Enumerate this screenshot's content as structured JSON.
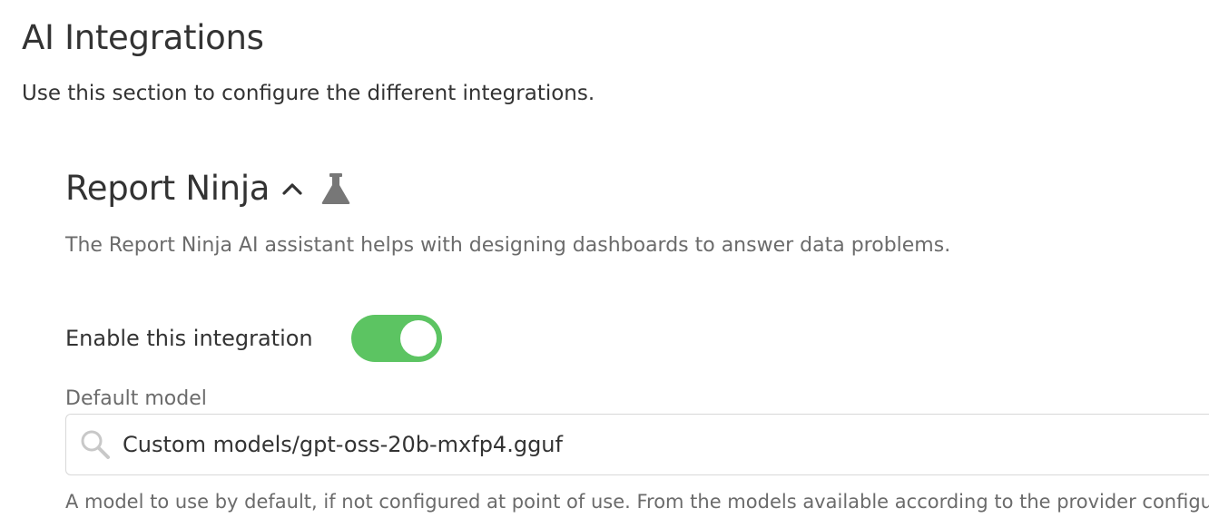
{
  "page": {
    "title": "AI Integrations",
    "description": "Use this section to configure the different integrations."
  },
  "integration": {
    "name": "Report Ninja",
    "expanded": true,
    "icons": {
      "toggle_collapse": "chevron-up-icon",
      "badge": "flask-icon"
    },
    "description": "The Report Ninja AI assistant helps with designing dashboards to answer data problems.",
    "enable": {
      "label": "Enable this integration",
      "enabled": true,
      "on_color": "#5cc462"
    },
    "default_model": {
      "label": "Default model",
      "value": "Custom models/gpt-oss-20b-mxfp4.gguf",
      "icon": "search-icon",
      "help": "A model to use by default, if not configured at point of use. From the models available according to the provider configur"
    }
  }
}
